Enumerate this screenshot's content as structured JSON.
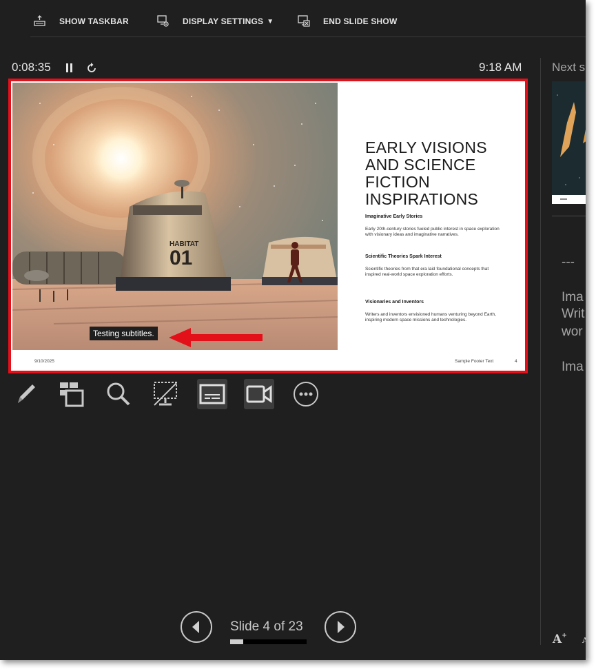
{
  "toolbar": {
    "show_taskbar": "SHOW TASKBAR",
    "display_settings": "DISPLAY SETTINGS",
    "end_slide_show": "END SLIDE SHOW"
  },
  "timer": {
    "elapsed": "0:08:35",
    "clock": "9:18 AM"
  },
  "current_slide": {
    "title": "EARLY VISIONS AND SCIENCE FICTION INSPIRATIONS",
    "sections": [
      {
        "heading": "Imaginative Early Stories",
        "body": "Early 20th-century stories fueled public interest in space exploration with visionary ideas and imaginative narratives."
      },
      {
        "heading": "Scientific Theories Spark Interest",
        "body": "Scientific theories from that era laid foundational concepts that inspired real-world space exploration efforts."
      },
      {
        "heading": "Visionaries and Inventors",
        "body": "Writers and inventors envisioned humans venturing beyond Earth, inspiring modern space missions and technologies."
      }
    ],
    "footer_date": "9/10/2025",
    "footer_text": "Sample Footer Text",
    "page_number": "4",
    "habitat_label": "HABITAT",
    "habitat_number": "01",
    "subtitle": "Testing subtitles."
  },
  "navigation": {
    "slide_counter": "Slide 4 of 23",
    "progress_fraction": 0.174
  },
  "next_slide": {
    "label": "Next s"
  },
  "notes": {
    "lines": [
      "---",
      "Ima",
      "Writ",
      "wor",
      "Ima"
    ]
  },
  "icons": {
    "show_taskbar": "taskbar-icon",
    "display_settings": "display-settings-icon",
    "end_slide_show": "end-show-icon",
    "pause": "pause-icon",
    "reset": "reset-icon",
    "tools": [
      "pen-icon",
      "all-slides-icon",
      "zoom-icon",
      "black-screen-icon",
      "subtitles-icon",
      "camera-icon",
      "more-options-icon"
    ],
    "prev": "chevron-left-icon",
    "next": "chevron-right-icon"
  },
  "colors": {
    "background": "#1f1f1f",
    "highlight": "#e3101a",
    "text": "#e6e6e6"
  }
}
